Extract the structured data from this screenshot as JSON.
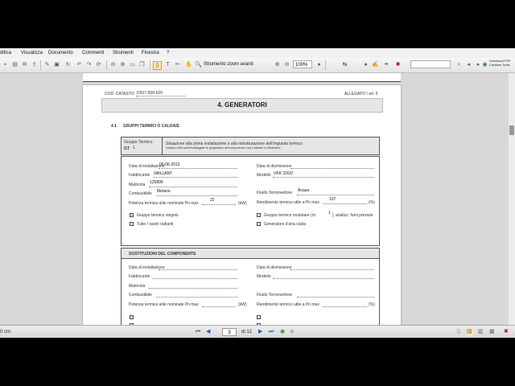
{
  "menubar": {
    "items": [
      "difica",
      "Visualizza",
      "Documento",
      "Commenti",
      "Strumenti",
      "Finestra",
      "?"
    ]
  },
  "toolbar": {
    "tool_label": "Strumento zoom avanti",
    "zoom": "100%",
    "promo_line1": "Download PDF",
    "promo_line2": "Creation Tools"
  },
  "document": {
    "cod_label": "COD. CATASTO",
    "cod_value": "D257-000-529",
    "allegato": "ALLEGATO I art. 5",
    "section_title": "4. GENERATORI",
    "section_num": "4.1",
    "section_heading": "GRUPPI TERMICI O CALDAIE",
    "group_label": "Gruppo Termico",
    "group_code": "GT",
    "group_code_value": "1",
    "situation_line1": "Situazione alla prima installazione o alla ristrutturazione dell'impianto termico",
    "situation_line2": "Indicare nelle pareti tratteggiate le progressivo del componente e sul e attivato in riferimento",
    "left_fields": [
      {
        "label": "Data di installazione",
        "value": "05-06-2012"
      },
      {
        "label": "Fabbricante",
        "value": "VAILLANT"
      },
      {
        "label": "Matricola",
        "value": "125896"
      },
      {
        "label": "Combustibile",
        "value": "Metano"
      },
      {
        "label": "Potenza termica utile nominale Pn max",
        "value": "22",
        "unit": "(kW)"
      }
    ],
    "right_fields": [
      {
        "label": "Data di dismissione",
        "value": ""
      },
      {
        "label": "Modello",
        "value": "VKK 226/2"
      },
      {
        "label": "Fluido Termovettore",
        "value": "Acqua"
      },
      {
        "label": "Rendimento termico utile a Pn max",
        "value": "107",
        "unit": "(%)"
      }
    ],
    "checkboxes": [
      {
        "label": "Gruppo termico singolo",
        "checked": true
      },
      {
        "label": "Tubo / nastri radianti",
        "checked": false
      },
      {
        "label": "Gruppo termico modulare (nr.",
        "value": "1",
        "suffix": ")",
        "extra": "analizz. fumi previste",
        "checked": false
      },
      {
        "label": "Generatore d'aria calda",
        "checked": false
      }
    ],
    "subst_heading": "SOSTITUZIONI DEL COMPONENTE",
    "subst_left": [
      "Data di installazione",
      "Fabbricante",
      "Matricola",
      "Combustibile",
      "Potenza termica utile nominale Pn max"
    ],
    "subst_left_unit": "(kW)",
    "subst_right": [
      "Data di dismissione",
      "Modello",
      "Fluido Termovettore",
      "Rendimento termico utile a Pn max"
    ],
    "subst_right_unit": "(%)"
  },
  "statusbar": {
    "dimension": "0 cm",
    "page_current": "3",
    "page_total": "di 12"
  },
  "colors": {
    "accent": "#2a5db0",
    "page_bg": "#ffffff",
    "viewport_bg": "#d7d7d7"
  }
}
